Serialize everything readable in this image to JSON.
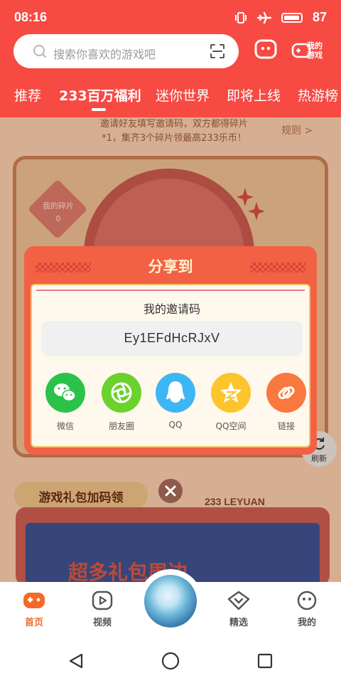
{
  "status": {
    "time": "08:16",
    "battery": "87"
  },
  "search": {
    "placeholder": "搜索你喜欢的游戏吧"
  },
  "header": {
    "my_games_line1": "我的",
    "my_games_line2": "游戏"
  },
  "tabs": [
    {
      "label": "推荐",
      "active": false
    },
    {
      "label": "233百万福利",
      "active": true
    },
    {
      "label": "迷你世界",
      "active": false
    },
    {
      "label": "即将上线",
      "active": false
    },
    {
      "label": "热游榜",
      "active": false
    }
  ],
  "background": {
    "banner_line1": "邀请好友填写邀请码，双方都得碎片",
    "banner_line2": "*1，集齐3个碎片领最高233乐币！",
    "rules": "规则 >",
    "fragments_label": "我的碎片",
    "fragments_count": "0",
    "refresh": "刷新",
    "gift_title": "游戏礼包加码领",
    "leyuan": "233 LEYUAN",
    "promo_text": "超多礼包周边"
  },
  "share_dialog": {
    "title": "分享到",
    "invite_label": "我的邀请码",
    "invite_code": "Ey1EFdHcRJxV",
    "options": [
      {
        "label": "微信",
        "icon": "wechat-icon",
        "color": "#2bc24a"
      },
      {
        "label": "朋友圈",
        "icon": "moments-icon",
        "color": "#6bd12c"
      },
      {
        "label": "QQ",
        "icon": "qq-icon",
        "color": "#3db6f4"
      },
      {
        "label": "QQ空间",
        "icon": "qzone-icon",
        "color": "#fcc52c"
      },
      {
        "label": "链接",
        "icon": "link-icon",
        "color": "#f9783f"
      }
    ]
  },
  "bottom_nav": [
    {
      "label": "首页",
      "icon": "gamepad-icon",
      "active": true
    },
    {
      "label": "视频",
      "icon": "video-icon",
      "active": false
    },
    {
      "label": "精选",
      "icon": "heart-chat-icon",
      "active": false
    },
    {
      "label": "我的",
      "icon": "face-icon",
      "active": false
    }
  ],
  "colors": {
    "brand": "#f64a43",
    "accent_orange": "#f46a2a",
    "dialog": "#f26144"
  }
}
